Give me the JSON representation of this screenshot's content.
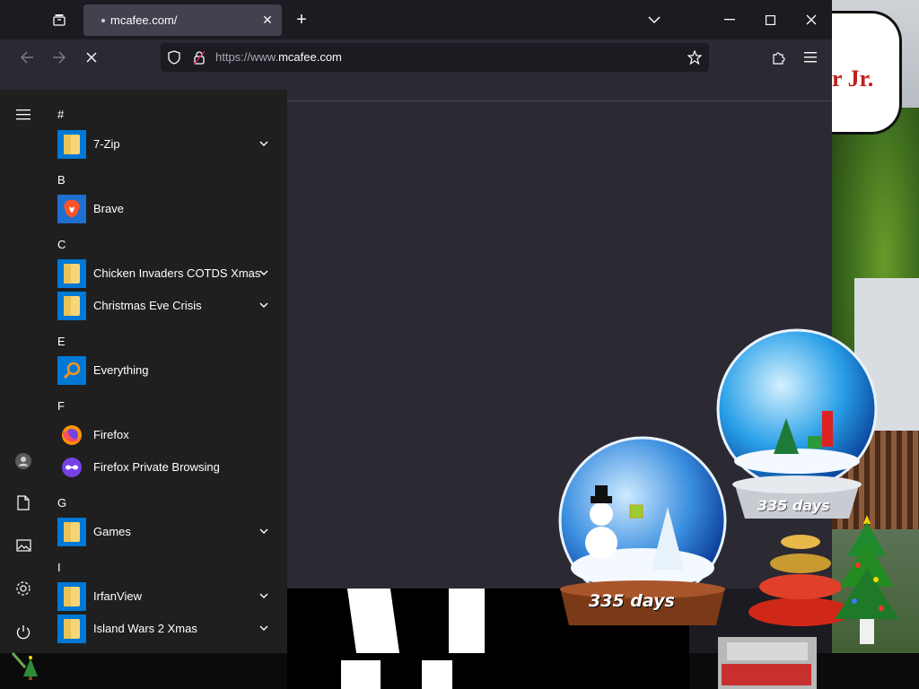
{
  "browser": {
    "tab": {
      "title": "mcafee.com/"
    },
    "url": {
      "protocol": "https://www.",
      "domain": "mcafee.com"
    }
  },
  "start_menu": {
    "groups": [
      {
        "letter": "#",
        "apps": [
          {
            "name": "7-Zip",
            "icon": "folder-icon",
            "expandable": true
          }
        ]
      },
      {
        "letter": "B",
        "apps": [
          {
            "name": "Brave",
            "icon": "brave-lion-icon",
            "expandable": false
          }
        ]
      },
      {
        "letter": "C",
        "apps": [
          {
            "name": "Chicken Invaders COTDS Xmas",
            "icon": "folder-icon",
            "expandable": true
          },
          {
            "name": "Christmas Eve Crisis",
            "icon": "folder-icon",
            "expandable": true
          }
        ]
      },
      {
        "letter": "E",
        "apps": [
          {
            "name": "Everything",
            "icon": "magnifier-icon",
            "expandable": false
          }
        ]
      },
      {
        "letter": "F",
        "apps": [
          {
            "name": "Firefox",
            "icon": "firefox-icon",
            "expandable": false
          },
          {
            "name": "Firefox Private Browsing",
            "icon": "firefox-private-icon",
            "expandable": false
          }
        ]
      },
      {
        "letter": "G",
        "apps": [
          {
            "name": "Games",
            "icon": "folder-icon",
            "expandable": true
          }
        ]
      },
      {
        "letter": "I",
        "apps": [
          {
            "name": "IrfanView",
            "icon": "folder-icon",
            "expandable": true
          },
          {
            "name": "Island Wars 2 Xmas",
            "icon": "folder-icon",
            "expandable": true
          }
        ]
      }
    ]
  },
  "desktop": {
    "snow_globe_left_label": "335 days",
    "snow_globe_right_label": "335 days",
    "speech_bubble_text": "r Jr."
  },
  "colors": {
    "accent": "#0078d4",
    "browser_bg": "#1c1b22",
    "toolbar": "#2b2a33",
    "menu_bg": "#1f1f1f",
    "folder": "#f5d77a"
  }
}
